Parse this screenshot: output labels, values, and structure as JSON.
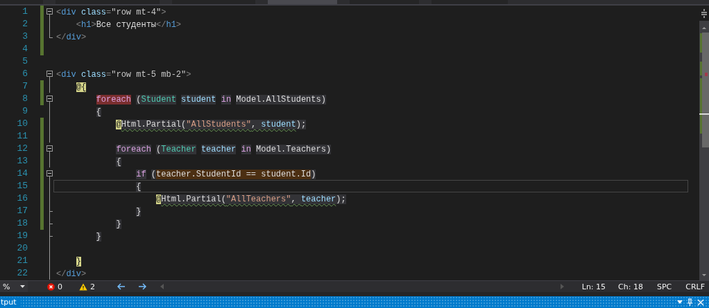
{
  "tabs": [
    {
      "selected": false
    },
    {
      "selected": false
    },
    {
      "selected": false
    },
    {
      "selected": true
    },
    {
      "selected": false
    },
    {
      "selected": false
    }
  ],
  "editor": {
    "lines": [
      {
        "number": "1",
        "changed": true,
        "kind": "fold-start",
        "current": false,
        "tokens": [
          {
            "kind": "punct",
            "t": "<"
          },
          {
            "kind": "tag",
            "t": "div"
          },
          {
            "kind": "attr",
            "t": " class"
          },
          {
            "kind": "punct",
            "t": "="
          },
          {
            "kind": "value",
            "t": "\"row mt-4\""
          },
          {
            "kind": "punct",
            "t": ">"
          }
        ]
      },
      {
        "number": "2",
        "changed": true,
        "kind": "fold-inner",
        "current": false,
        "tokens": [
          {
            "kind": "punct",
            "t": "    <"
          },
          {
            "kind": "tag",
            "t": "h1"
          },
          {
            "kind": "punct",
            "t": ">"
          },
          {
            "kind": "plain",
            "t": "Все студенты"
          },
          {
            "kind": "punct",
            "t": "</"
          },
          {
            "kind": "tag",
            "t": "h1"
          },
          {
            "kind": "punct",
            "t": ">"
          }
        ]
      },
      {
        "number": "3",
        "changed": true,
        "kind": "fold-last",
        "current": false,
        "tokens": [
          {
            "kind": "punct",
            "t": "</"
          },
          {
            "kind": "tag",
            "t": "div"
          },
          {
            "kind": "punct",
            "t": ">"
          }
        ]
      },
      {
        "number": "4",
        "changed": true,
        "kind": "plain",
        "current": false
      },
      {
        "number": "5",
        "changed": false,
        "kind": "plain",
        "current": false
      },
      {
        "number": "6",
        "changed": false,
        "kind": "fold-start",
        "current": false,
        "tokens": [
          {
            "kind": "punct",
            "t": "<"
          },
          {
            "kind": "tag",
            "t": "div"
          },
          {
            "kind": "attr",
            "t": " class"
          },
          {
            "kind": "punct",
            "t": "="
          },
          {
            "kind": "value",
            "t": "\"row mt-5 mb-2\""
          },
          {
            "kind": "punct",
            "t": ">"
          }
        ]
      },
      {
        "number": "7",
        "changed": true,
        "kind": "fold-inner",
        "current": false,
        "tokens": [
          {
            "kind": "razor",
            "t": "    @{"
          }
        ]
      },
      {
        "number": "8",
        "changed": true,
        "kind": "fold-start",
        "current": false,
        "tokens": [
          {
            "kind": "keyword",
            "t": "        foreach",
            "color": "#7a2e2e"
          },
          {
            "kind": "plain",
            "t": " (",
            "color": "#333337"
          },
          {
            "kind": "type",
            "t": "Student",
            "color": "#333337"
          },
          {
            "kind": "ident",
            "t": " student",
            "color": "#333337"
          },
          {
            "kind": "keyword",
            "t": " in",
            "color": "#333337"
          },
          {
            "kind": "plain",
            "t": " Model.AllStudents)",
            "color": "#333337"
          }
        ]
      },
      {
        "number": "9",
        "changed": false,
        "kind": "fold-inner",
        "current": false,
        "tokens": [
          {
            "kind": "plain",
            "t": "        {",
            "color": "#333337"
          }
        ]
      },
      {
        "number": "10",
        "changed": true,
        "kind": "fold-inner",
        "current": false,
        "tokens": [
          {
            "kind": "razor",
            "t": "            @"
          },
          {
            "kind": "plain",
            "t": "Html.Partial(",
            "color": "#333337",
            "squiggle": true
          },
          {
            "kind": "string",
            "t": "\"AllStudents\"",
            "color": "#333337",
            "squiggle": true
          },
          {
            "kind": "plain",
            "t": ", ",
            "color": "#333337",
            "squiggle": true
          },
          {
            "kind": "ident",
            "t": "student",
            "color": "#333337",
            "squiggle": true
          },
          {
            "kind": "plain",
            "t": ");",
            "color": "#333337",
            "squiggle": false
          }
        ]
      },
      {
        "number": "11",
        "changed": true,
        "kind": "fold-inner",
        "current": false
      },
      {
        "number": "12",
        "changed": true,
        "kind": "fold-start",
        "current": false,
        "tokens": [
          {
            "kind": "keyword",
            "t": "            foreach",
            "color": "#333337"
          },
          {
            "kind": "plain",
            "t": " (",
            "color": "#333337"
          },
          {
            "kind": "type",
            "t": "Teacher",
            "color": "#333337"
          },
          {
            "kind": "ident",
            "t": " teacher",
            "color": "#333337"
          },
          {
            "kind": "keyword",
            "t": " in",
            "color": "#333337"
          },
          {
            "kind": "plain",
            "t": " Model.Teachers)",
            "color": "#333337"
          }
        ]
      },
      {
        "number": "13",
        "changed": true,
        "kind": "fold-inner",
        "current": false,
        "tokens": [
          {
            "kind": "plain",
            "t": "            {",
            "color": "#333337"
          }
        ]
      },
      {
        "number": "14",
        "changed": true,
        "kind": "fold-start",
        "current": false,
        "tokens": [
          {
            "kind": "keyword",
            "t": "                if",
            "color": "#333337"
          },
          {
            "kind": "plain",
            "t": " (",
            "color": "#333337"
          },
          {
            "kind": "plain",
            "t": "teacher.StudentId == student.Id",
            "color": "#4c2f12"
          },
          {
            "kind": "plain",
            "t": ")",
            "color": "#333337"
          }
        ]
      },
      {
        "number": "15",
        "changed": true,
        "kind": "fold-inner",
        "current": true,
        "tokens": [
          {
            "kind": "plain",
            "t": "                {",
            "color": "#333337"
          }
        ]
      },
      {
        "number": "16",
        "changed": true,
        "kind": "fold-inner",
        "current": false,
        "tokens": [
          {
            "kind": "razor",
            "t": "                    @"
          },
          {
            "kind": "plain",
            "t": "Html.Partial(",
            "color": "#333337",
            "squiggle": true
          },
          {
            "kind": "string",
            "t": "\"AllTeachers\"",
            "color": "#333337",
            "squiggle": true
          },
          {
            "kind": "plain",
            "t": ", ",
            "color": "#333337",
            "squiggle": true
          },
          {
            "kind": "ident",
            "t": "teacher",
            "color": "#333337",
            "squiggle": true
          },
          {
            "kind": "plain",
            "t": ");",
            "color": "#333337",
            "squiggle": false
          }
        ]
      },
      {
        "number": "17",
        "changed": true,
        "kind": "fold-end",
        "current": false,
        "tokens": [
          {
            "kind": "plain",
            "t": "                }",
            "color": "#333337"
          }
        ]
      },
      {
        "number": "18",
        "changed": true,
        "kind": "fold-end",
        "current": false,
        "tokens": [
          {
            "kind": "plain",
            "t": "            }",
            "color": "#333337"
          }
        ]
      },
      {
        "number": "19",
        "changed": false,
        "kind": "fold-end",
        "current": false,
        "tokens": [
          {
            "kind": "plain",
            "t": "        }",
            "color": "#333337"
          }
        ]
      },
      {
        "number": "20",
        "changed": false,
        "kind": "fold-inner",
        "current": false
      },
      {
        "number": "21",
        "changed": false,
        "kind": "fold-inner",
        "current": false,
        "tokens": [
          {
            "kind": "razor",
            "t": "    }"
          }
        ]
      },
      {
        "number": "22",
        "changed": false,
        "kind": "fold-inner",
        "current": false,
        "tokens": [
          {
            "kind": "punct",
            "t": "</"
          },
          {
            "kind": "tag",
            "t": "div"
          },
          {
            "kind": "punct",
            "t": ">"
          }
        ]
      }
    ]
  },
  "status_bar": {
    "zoom": "%",
    "errors": "0",
    "warnings": "2",
    "line": "Ln: 15",
    "column": "Ch: 18",
    "indent": "SPC",
    "line_ending": "CRLF"
  },
  "output_panel": {
    "title": "tput"
  }
}
